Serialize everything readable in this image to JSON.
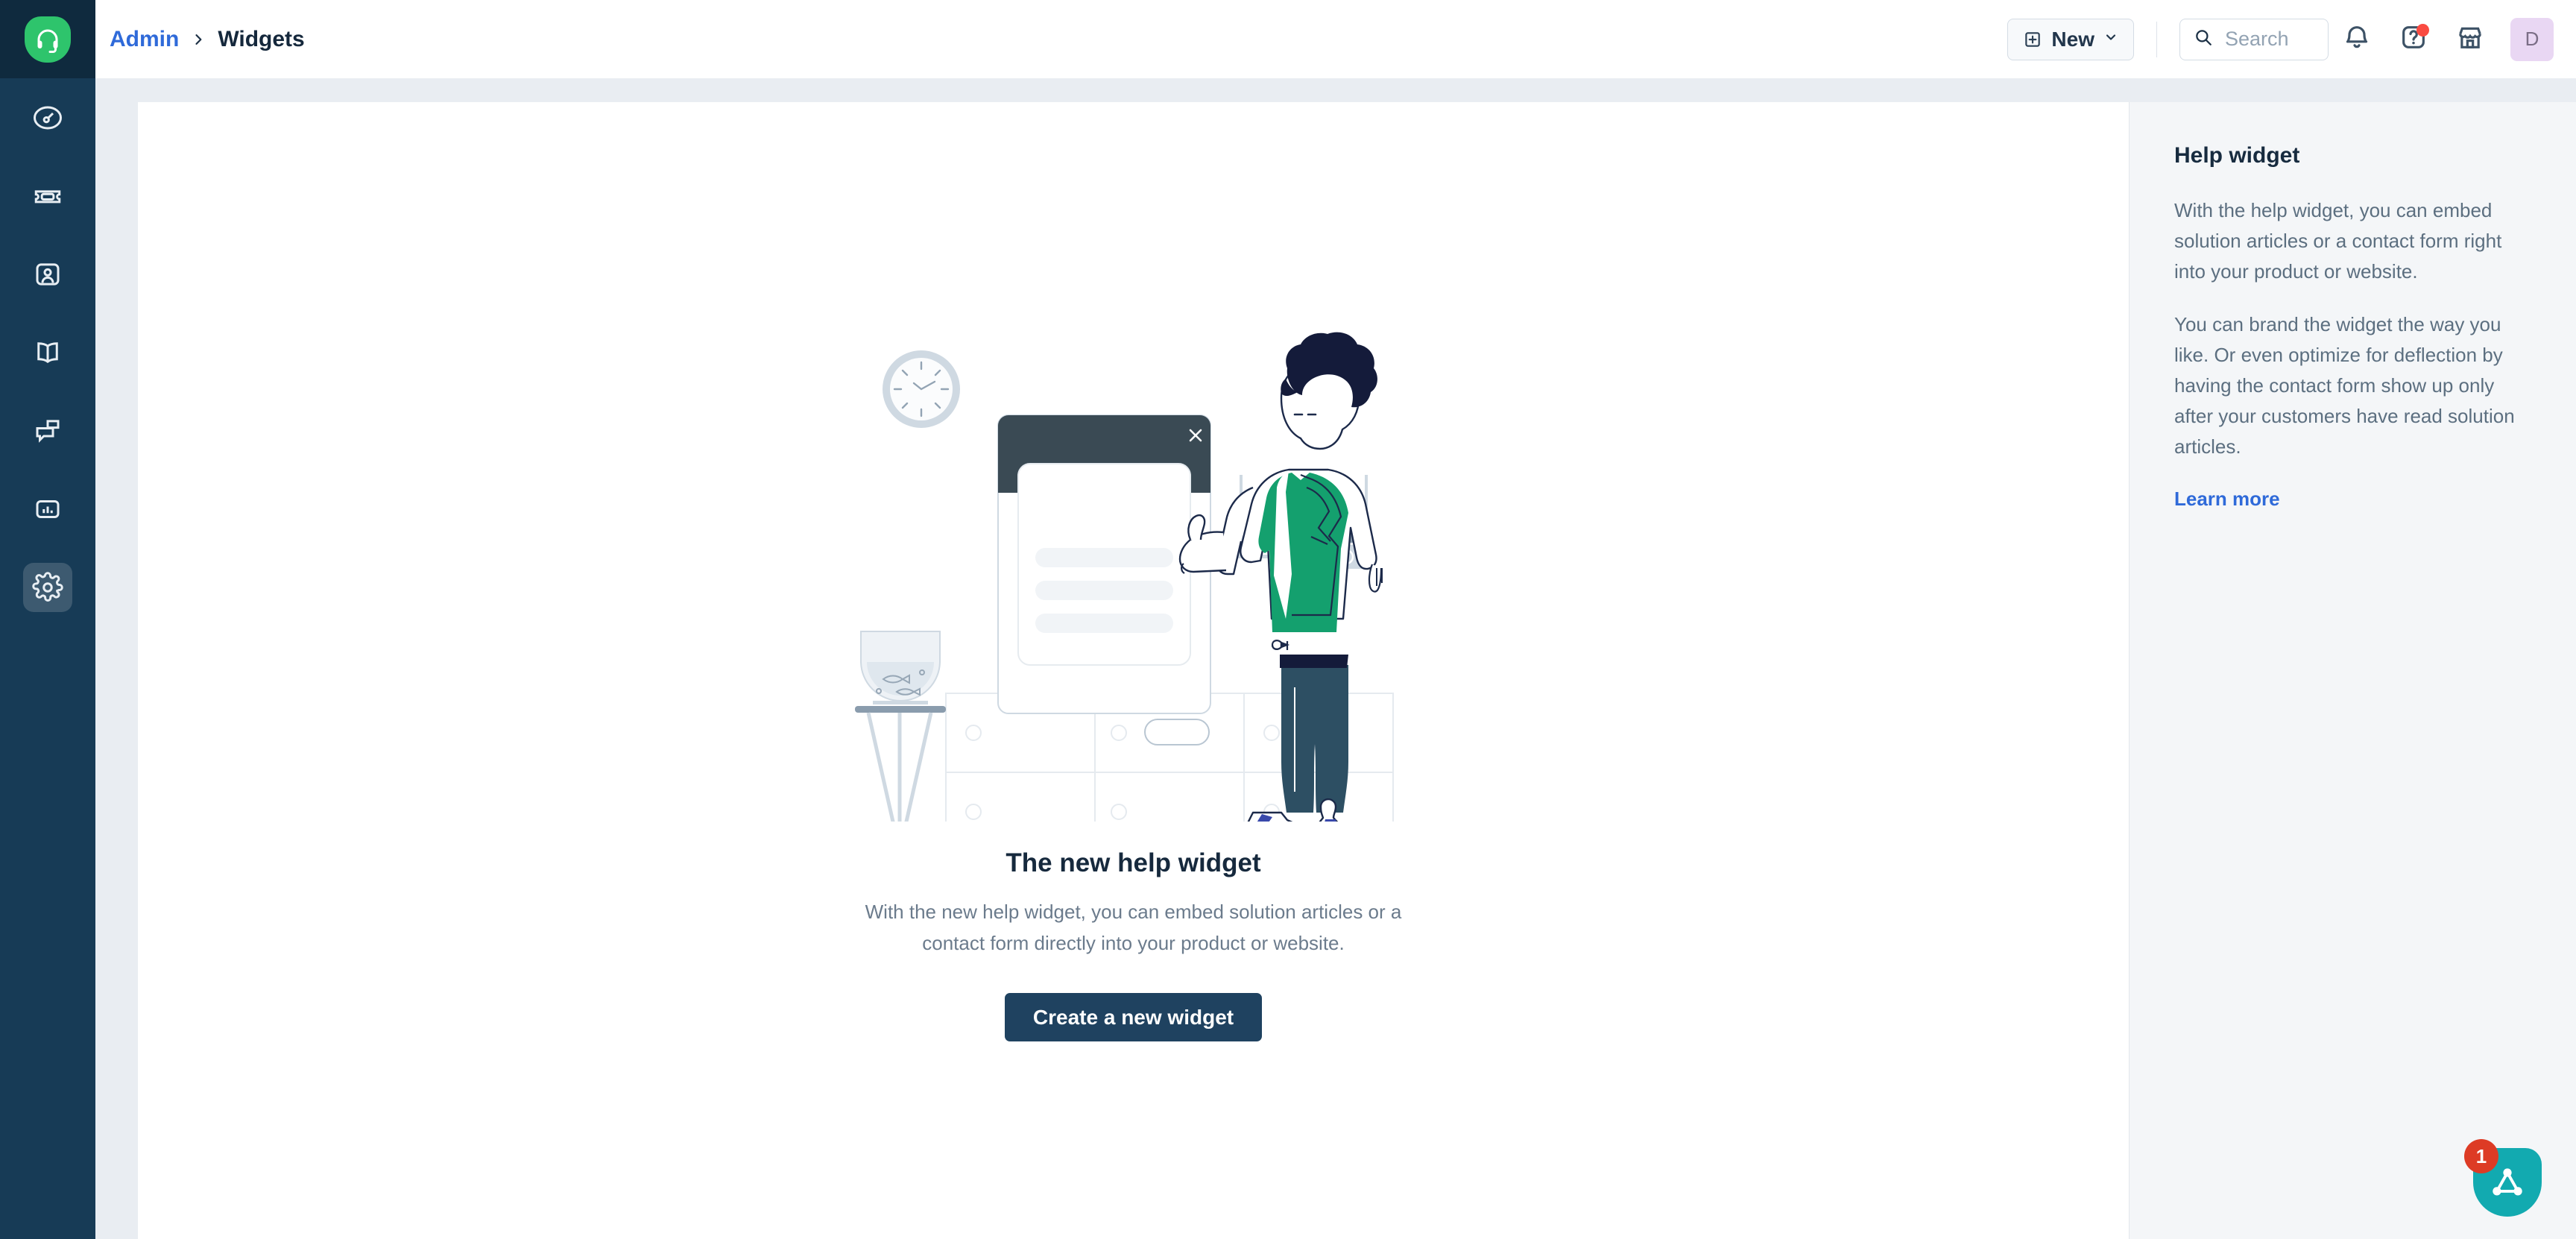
{
  "brand": {
    "logo_icon": "headset-icon",
    "logo_color": "#2ec46c",
    "rail_color": "#173b56"
  },
  "breadcrumb": {
    "parent": "Admin",
    "separator_icon": "chevron-right-icon",
    "current": "Widgets"
  },
  "sidebar": {
    "items": [
      {
        "name": "dashboard",
        "icon": "gauge-icon",
        "active": false
      },
      {
        "name": "tickets",
        "icon": "ticket-icon",
        "active": false
      },
      {
        "name": "contacts",
        "icon": "contact-card-icon",
        "active": false
      },
      {
        "name": "knowledge-base",
        "icon": "book-icon",
        "active": false
      },
      {
        "name": "conversations",
        "icon": "chat-bubbles-icon",
        "active": false
      },
      {
        "name": "reports",
        "icon": "bar-chart-icon",
        "active": false
      },
      {
        "name": "admin-settings",
        "icon": "gear-icon",
        "active": true
      }
    ]
  },
  "toolbar": {
    "new_label": "New",
    "new_icon": "plus-square-icon",
    "new_chevron_icon": "chevron-down-icon",
    "search_placeholder": "Search",
    "search_icon": "search-icon",
    "notifications_icon": "bell-icon",
    "help_icon": "question-mark-icon",
    "help_has_badge": true,
    "marketplace_icon": "storefront-icon",
    "avatar_initial": "D",
    "avatar_color": "#e9d7f3"
  },
  "empty_state": {
    "illustration": "help-widget-illustration",
    "title": "The new help widget",
    "description": "With the new help widget, you can embed solution articles or a contact form directly into your product or website.",
    "cta_label": "Create a new widget",
    "cta_color": "#1f4260"
  },
  "help_panel": {
    "title": "Help widget",
    "paragraph_1": "With the help widget, you can embed solution articles or a contact form right into your product or website.",
    "paragraph_2": "You can brand the widget the way you like. Or even optimize for deflection by having the contact form show up only after your customers have read solution articles.",
    "link_label": "Learn more",
    "link_color": "#2f6ad9"
  },
  "chat_fab": {
    "icon": "network-triangle-icon",
    "badge_count": "1",
    "color": "#12aab0",
    "badge_color": "#dd3b25"
  }
}
